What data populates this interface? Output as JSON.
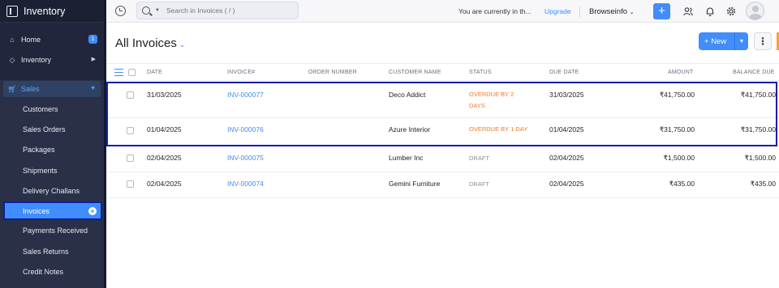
{
  "app": {
    "title": "Inventory"
  },
  "sidebar": {
    "home": {
      "label": "Home",
      "badge": "1"
    },
    "inventory": {
      "label": "Inventory"
    },
    "sales": {
      "label": "Sales",
      "items": [
        "Customers",
        "Sales Orders",
        "Packages",
        "Shipments",
        "Delivery Challans",
        "Invoices",
        "Payments Received",
        "Sales Returns",
        "Credit Notes"
      ]
    }
  },
  "topbar": {
    "search_placeholder": "Search in Invoices ( / )",
    "trial_text": "You are currently in th...",
    "upgrade_label": "Upgrade",
    "org_name": "Browseinfo"
  },
  "page": {
    "title": "All Invoices",
    "new_label": "New"
  },
  "table": {
    "headers": {
      "date": "DATE",
      "invoice": "INVOICE#",
      "order": "ORDER NUMBER",
      "customer": "CUSTOMER NAME",
      "status": "STATUS",
      "due": "DUE DATE",
      "amount": "AMOUNT",
      "balance": "BALANCE DUE"
    },
    "rows": [
      {
        "date": "31/03/2025",
        "invoice": "INV-000077",
        "order": "",
        "customer": "Deco Addict",
        "status_line1": "OVERDUE BY 2",
        "status_line2": "DAYS",
        "due": "31/03/2025",
        "amount": "₹41,750.00",
        "balance": "₹41,750.00"
      },
      {
        "date": "01/04/2025",
        "invoice": "INV-000076",
        "order": "",
        "customer": "Azure Interior",
        "status_line1": "OVERDUE BY 1 DAY",
        "status_line2": "",
        "due": "01/04/2025",
        "amount": "₹31,750.00",
        "balance": "₹31,750.00"
      },
      {
        "date": "02/04/2025",
        "invoice": "INV-000075",
        "order": "",
        "customer": "Lumber Inc",
        "status_line1": "DRAFT",
        "status_line2": "",
        "due": "02/04/2025",
        "amount": "₹1,500.00",
        "balance": "₹1,500.00"
      },
      {
        "date": "02/04/2025",
        "invoice": "INV-000074",
        "order": "",
        "customer": "Gemini Furniture",
        "status_line1": "DRAFT",
        "status_line2": "",
        "due": "02/04/2025",
        "amount": "₹435.00",
        "balance": "₹435.00"
      }
    ]
  },
  "colors": {
    "accent": "#408dfb",
    "sidebar": "#21263c",
    "overdue": "#f0772a",
    "highlight": "#0b1fa8"
  }
}
